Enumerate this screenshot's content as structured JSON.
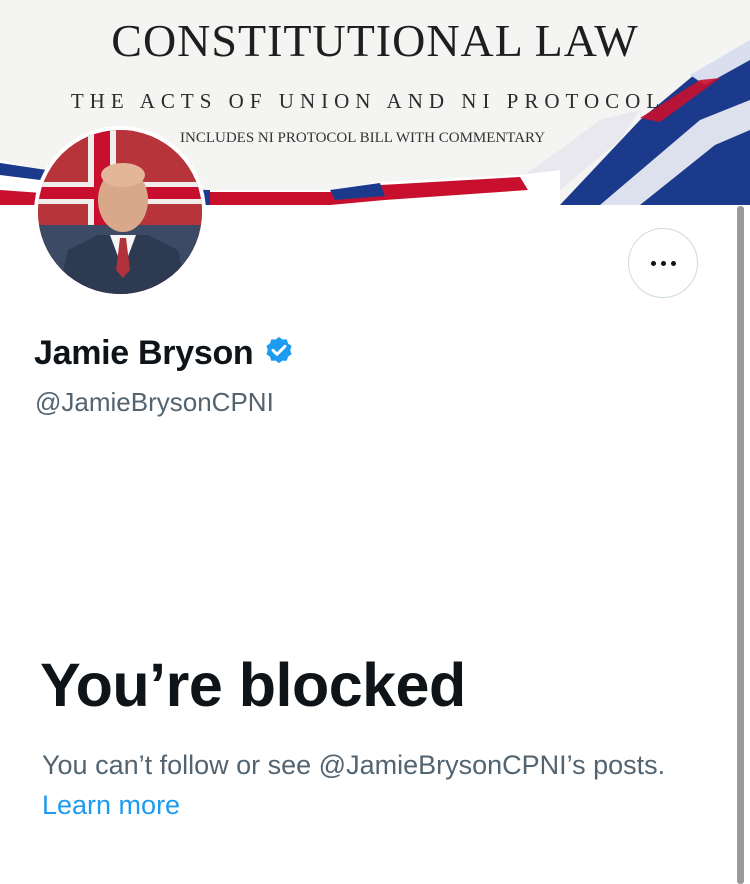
{
  "banner": {
    "title": "CONSTITUTIONAL LAW",
    "subtitle": "THE ACTS OF UNION AND NI PROTOCOL",
    "subtitle2": "INCLUDES NI PROTOCOL BILL WITH COMMENTARY"
  },
  "profile": {
    "name": "Jamie Bryson",
    "handle": "@JamieBrysonCPNI",
    "verified_color": "#1d9bf0"
  },
  "blocked": {
    "title": "You’re blocked",
    "message": "You can’t follow or see @JamieBrysonCPNI’s posts.",
    "link": "Learn more"
  },
  "colors": {
    "link": "#1d9bf0",
    "secondary_text": "#536471",
    "primary_text": "#0f1419"
  },
  "icons": {
    "more": "more-horizontal-icon",
    "verified": "verified-badge-icon"
  }
}
